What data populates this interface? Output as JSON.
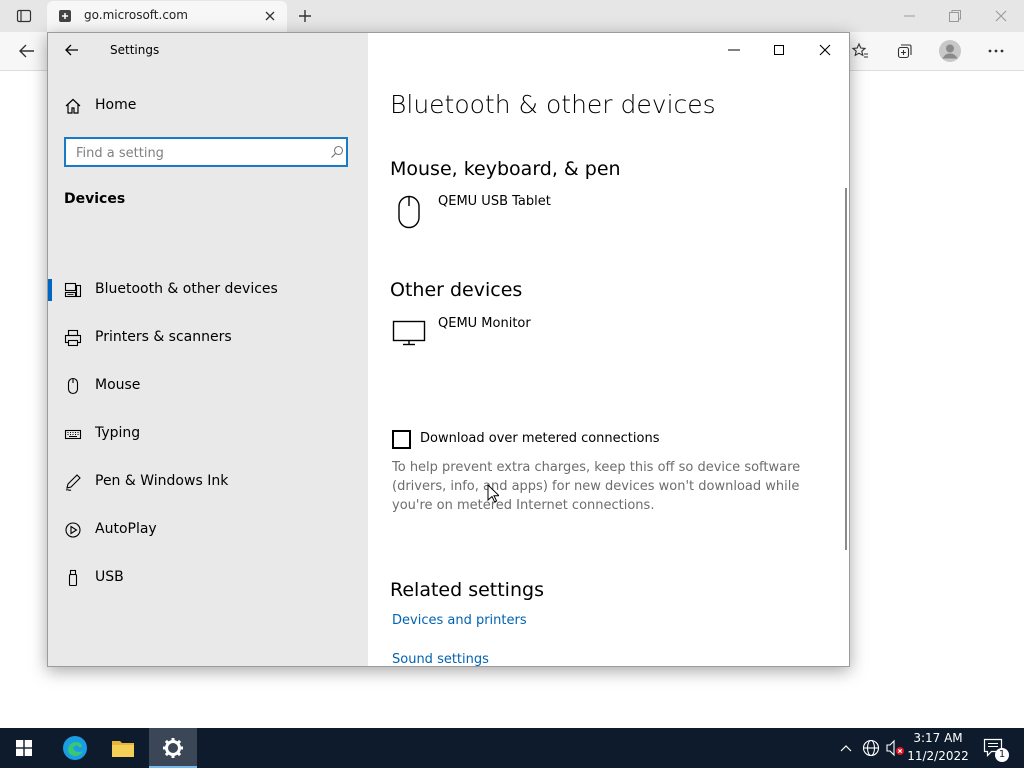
{
  "browser": {
    "tab_title": "go.microsoft.com"
  },
  "window": {
    "title": "Settings"
  },
  "sidebar": {
    "home_label": "Home",
    "search_placeholder": "Find a setting",
    "section_title": "Devices",
    "items": [
      {
        "label": "Bluetooth & other devices",
        "icon": "bluetooth-devices-icon",
        "active": true
      },
      {
        "label": "Printers & scanners",
        "icon": "printer-icon"
      },
      {
        "label": "Mouse",
        "icon": "mouse-icon"
      },
      {
        "label": "Typing",
        "icon": "keyboard-icon"
      },
      {
        "label": "Pen & Windows Ink",
        "icon": "pen-icon"
      },
      {
        "label": "AutoPlay",
        "icon": "autoplay-icon"
      },
      {
        "label": "USB",
        "icon": "usb-icon"
      }
    ]
  },
  "main": {
    "page_title": "Bluetooth & other devices",
    "mouse_section": {
      "title": "Mouse, keyboard, & pen",
      "devices": [
        {
          "name": "QEMU USB Tablet",
          "icon": "mouse-icon"
        }
      ]
    },
    "other_section": {
      "title": "Other devices",
      "devices": [
        {
          "name": "QEMU Monitor",
          "icon": "monitor-icon"
        }
      ]
    },
    "metered": {
      "label": "Download over metered connections",
      "checked": false,
      "description": "To help prevent extra charges, keep this off so device software (drivers, info, and apps) for new devices won't download while you're on metered Internet connections."
    },
    "related": {
      "title": "Related settings",
      "links": [
        "Devices and printers",
        "Sound settings"
      ]
    }
  },
  "taskbar": {
    "time": "3:17 AM",
    "date": "11/2/2022",
    "notification_count": "1"
  },
  "colors": {
    "accent": "#0067c0",
    "link": "#0063b1",
    "taskbar": "#0e1b2c"
  }
}
